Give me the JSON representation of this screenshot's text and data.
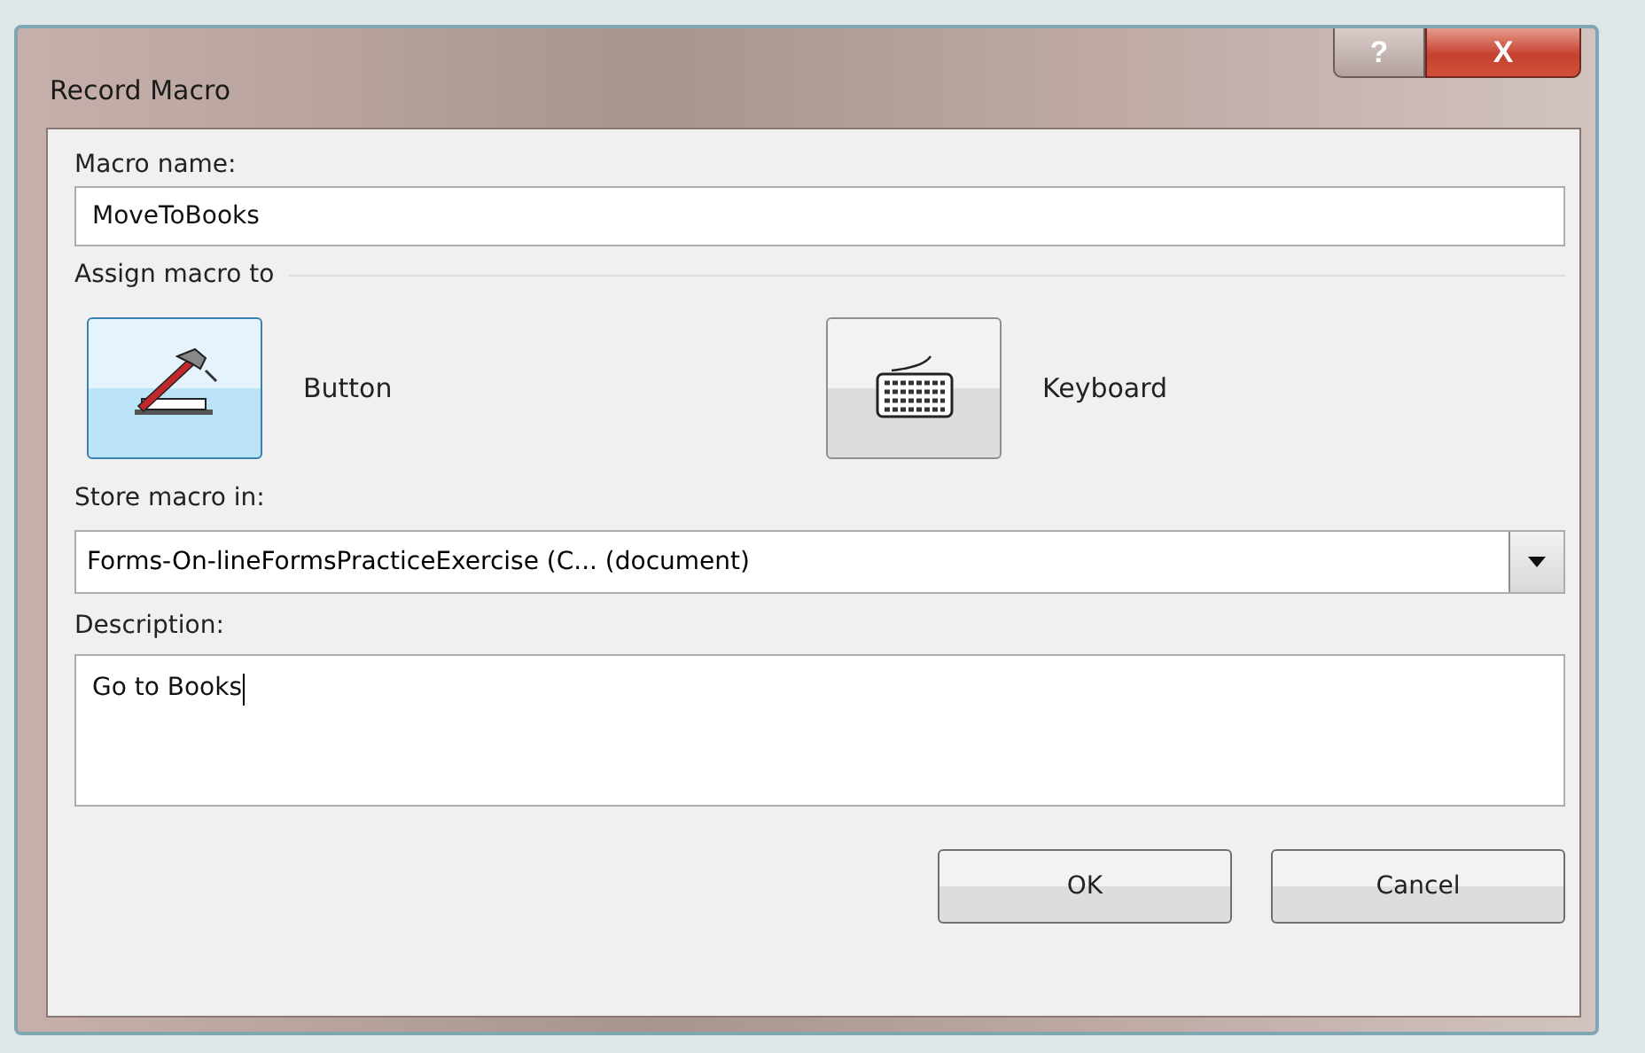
{
  "window": {
    "title": "Record Macro",
    "help_button": "?",
    "close_button": "X"
  },
  "macro_name": {
    "label": "Macro name:",
    "value": "MoveToBooks"
  },
  "assign": {
    "label": "Assign macro to",
    "options": [
      {
        "kind": "button",
        "label": "Button",
        "selected": true
      },
      {
        "kind": "keyboard",
        "label": "Keyboard",
        "selected": false
      }
    ]
  },
  "store": {
    "label": "Store macro in:",
    "value": "Forms-On-lineFormsPracticeExercise (C... (document)"
  },
  "description": {
    "label": "Description:",
    "value": "Go to Books"
  },
  "buttons": [
    "OK",
    "Cancel"
  ]
}
